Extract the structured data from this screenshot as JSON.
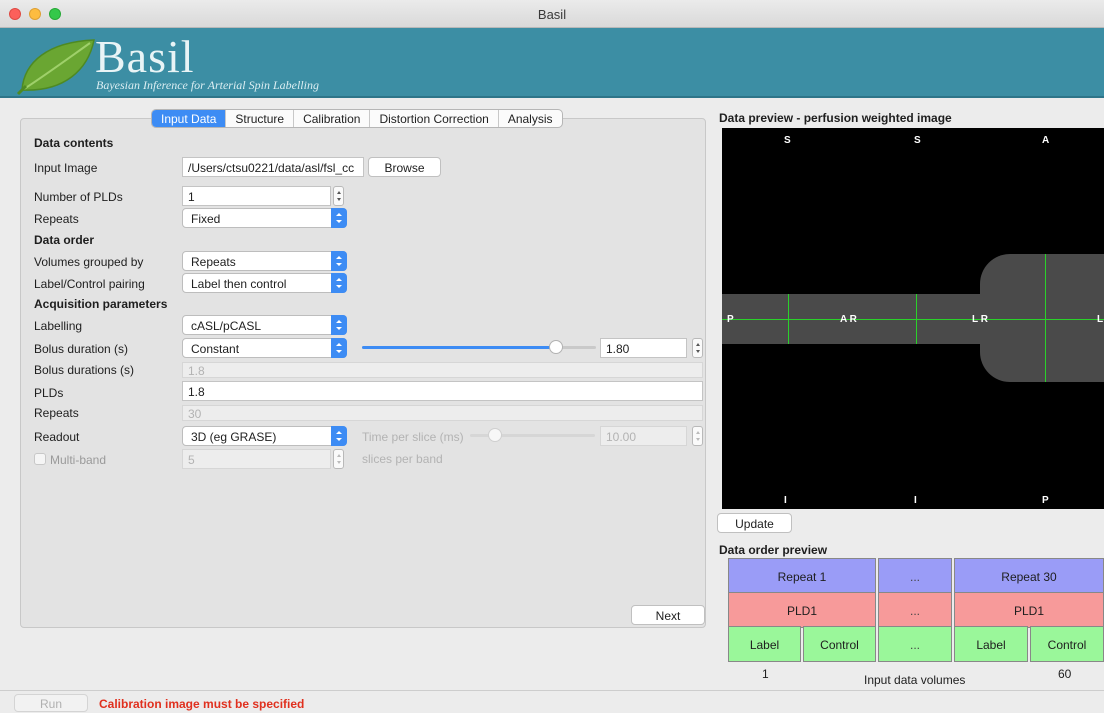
{
  "window": {
    "title": "Basil"
  },
  "banner": {
    "brand": "Basil",
    "tagline": "Bayesian Inference for Arterial Spin Labelling"
  },
  "tabs": [
    {
      "label": "Input Data",
      "active": true
    },
    {
      "label": "Structure"
    },
    {
      "label": "Calibration"
    },
    {
      "label": "Distortion Correction"
    },
    {
      "label": "Analysis"
    }
  ],
  "form": {
    "data_contents_heading": "Data contents",
    "input_image_label": "Input Image",
    "input_image_value": "/Users/ctsu0221/data/asl/fsl_cc",
    "browse_label": "Browse",
    "num_plds_label": "Number of PLDs",
    "num_plds_value": "1",
    "repeats_label": "Repeats",
    "repeats_value": "Fixed",
    "data_order_heading": "Data order",
    "grouped_label": "Volumes grouped by",
    "grouped_value": "Repeats",
    "pairing_label": "Label/Control pairing",
    "pairing_value": "Label then control",
    "acq_heading": "Acquisition parameters",
    "labelling_label": "Labelling",
    "labelling_value": "cASL/pCASL",
    "bolus_label": "Bolus duration (s)",
    "bolus_mode": "Constant",
    "bolus_value": "1.80",
    "bolus_slider_fraction": 0.83,
    "bolus_durations_label": "Bolus durations (s)",
    "bolus_durations_value": "1.8",
    "plds_label": "PLDs",
    "plds_value": "1.8",
    "repeats2_label": "Repeats",
    "repeats2_value": "30",
    "readout_label": "Readout",
    "readout_value": "3D (eg GRASE)",
    "time_per_slice_label": "Time per slice (ms)",
    "time_per_slice_value": "10.00",
    "time_slider_fraction": 0.2,
    "multiband_label": "Multi-band",
    "multiband_value": "5",
    "slices_per_band_label": "slices per band",
    "next_label": "Next"
  },
  "preview": {
    "title": "Data preview - perfusion weighted image",
    "orientation": {
      "top1": "S",
      "top2": "S",
      "top3": "A",
      "bottom1": "I",
      "bottom2": "I",
      "bottom3": "P",
      "left1": "P",
      "mid1": "A R",
      "mid2": "L R",
      "right1": "L"
    },
    "update_label": "Update"
  },
  "order_preview": {
    "title": "Data order preview",
    "repeat_first": "Repeat 1",
    "repeat_dots": "...",
    "repeat_last": "Repeat 30",
    "pld_first": "PLD1",
    "pld_dots": "...",
    "pld_last": "PLD1",
    "label_a": "Label",
    "control_a": "Control",
    "tc_dots": "...",
    "label_b": "Label",
    "control_b": "Control",
    "vol_first": "1",
    "vol_caption": "Input data volumes",
    "vol_last": "60"
  },
  "statusbar": {
    "run_label": "Run",
    "message": "Calibration image must be specified"
  },
  "colors": {
    "accent": "#3d8cf4",
    "banner": "#3c8ea4",
    "error": "#e0301e"
  }
}
